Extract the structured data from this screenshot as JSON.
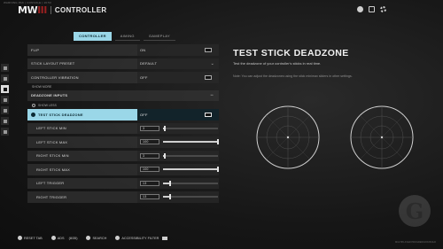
{
  "status_strip": "WARNING PAK | CONSOLE | 16:53",
  "app": {
    "logo_text": "MW",
    "logo_accent": "III",
    "title": "CONTROLLER"
  },
  "tabs": [
    {
      "label": "CONTROLLER",
      "active": true
    },
    {
      "label": "AIMING",
      "active": false
    },
    {
      "label": "GAMEPLAY",
      "active": false
    }
  ],
  "settings": {
    "row_flip": {
      "label": "FLIP",
      "value": "ON"
    },
    "stick_layout": {
      "label": "STICK LAYOUT PRESET",
      "value": "DEFAULT"
    },
    "vibration": {
      "label": "CONTROLLER VIBRATION",
      "value": "OFF"
    },
    "show_more": "SHOW MORE",
    "deadzone_header": "DEADZONE INPUTS",
    "show_less": "SHOW LESS",
    "test_deadzone": {
      "label": "TEST STICK DEADZONE",
      "value": "OFF"
    },
    "left_min": {
      "label": "LEFT STICK MIN",
      "value": "3",
      "fraction": 0.03
    },
    "left_max": {
      "label": "LEFT STICK MAX",
      "value": "100",
      "fraction": 1.0
    },
    "right_min": {
      "label": "RIGHT STICK MIN",
      "value": "3",
      "fraction": 0.03
    },
    "right_max": {
      "label": "RIGHT STICK MAX",
      "value": "100",
      "fraction": 1.0
    },
    "left_trigger": {
      "label": "LEFT TRIGGER",
      "value": "13",
      "fraction": 0.13
    },
    "right_trigger": {
      "label": "RIGHT TRIGGER",
      "value": "13",
      "fraction": 0.13
    }
  },
  "detail": {
    "title": "TEST STICK DEADZONE",
    "description": "Test the deadzone of your controller's sticks in real time.",
    "note": "Note: You can adjust the deadzones using the stick min/max sliders in other settings."
  },
  "footer": {
    "reset": "RESET TAB",
    "ads": "ADS",
    "ads_count": "(8/35)",
    "search": "SEARCH",
    "accessibility": "ACCESSIBILITY FILTER"
  },
  "build_text": "MULTIPLAYER PROGRESSION BUILD",
  "colors": {
    "accent": "#9ad7e8",
    "background": "#151515"
  },
  "icons": [
    "social-icon",
    "notifications-icon",
    "settings-gear-icon"
  ]
}
